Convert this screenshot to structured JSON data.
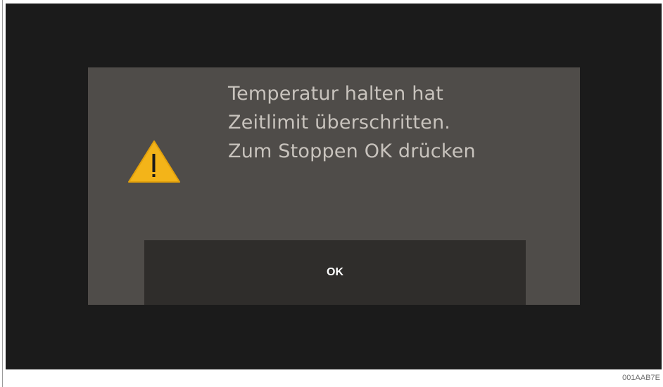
{
  "dialog": {
    "icon": "warning-icon",
    "message_lines": [
      "Temperatur halten hat",
      "Zeitlimit überschritten.",
      "Zum Stoppen OK drücken"
    ],
    "ok_label": "OK"
  },
  "image_code": "001AAB7E",
  "colors": {
    "screen_background": "#1b1b1b",
    "dialog_background": "#4f4c49",
    "button_background": "#2f2d2b",
    "message_text": "#c8c3bd",
    "warning_fill": "#f3b419"
  }
}
